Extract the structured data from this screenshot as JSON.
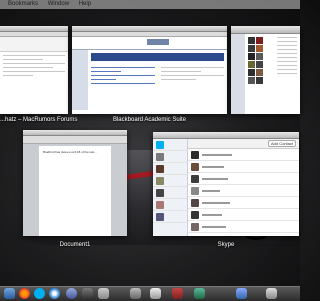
{
  "menubar": {
    "items": [
      "Bookmarks",
      "Window",
      "Help"
    ]
  },
  "windows": {
    "forums": {
      "caption": "...hatz – MacRumors Forums"
    },
    "blackboard": {
      "caption": "Blackboard Academic Suite"
    },
    "document": {
      "caption": "Document1",
      "doc_text": "Bradford has tissues at 0:18 of the last..."
    },
    "skype": {
      "caption": "Skype",
      "add_contact": "Add Contact"
    },
    "itunes": {
      "caption": ""
    }
  },
  "dock": {
    "icons": [
      "finder-icon",
      "firefox-icon",
      "skype-icon",
      "safari-icon",
      "itunes-icon",
      "game-icon",
      "preview-icon",
      "mail-icon",
      "app-icon",
      "photos-icon",
      "app-store-icon",
      "folder-icon",
      "trash-icon"
    ]
  },
  "colors": {
    "accent": "#2a4fb0",
    "skype": "#00aff0"
  }
}
